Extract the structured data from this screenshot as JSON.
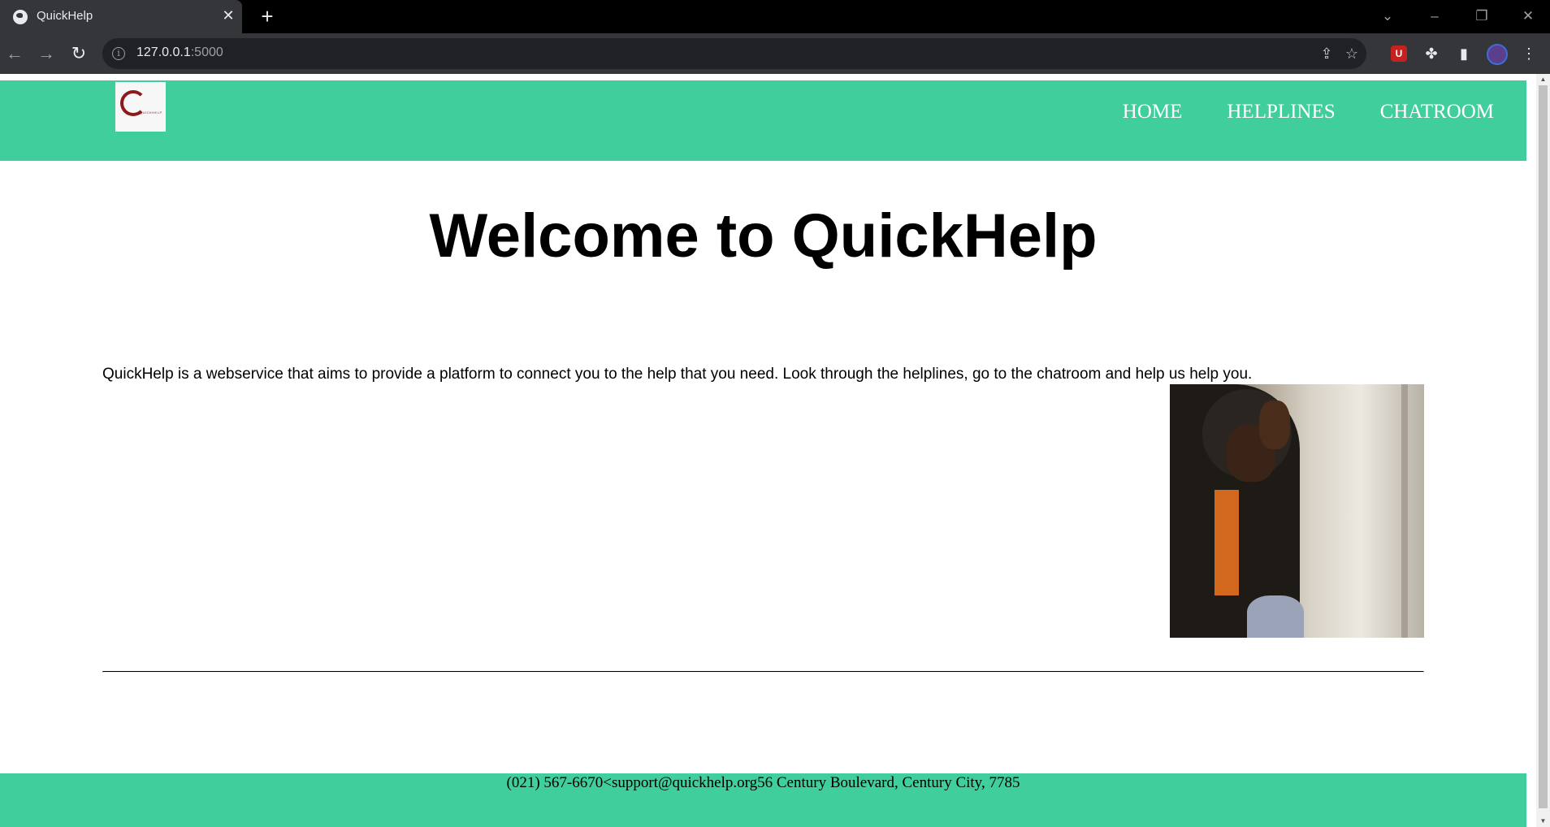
{
  "browser": {
    "tab_title": "QuickHelp",
    "url_host": "127.0.0.1",
    "url_port": ":5000"
  },
  "site": {
    "logo_text": "QUICKHELP",
    "nav": [
      {
        "label": "HOME"
      },
      {
        "label": "HELPLINES"
      },
      {
        "label": "CHATROOM"
      }
    ],
    "title": "Welcome to QuickHelp",
    "intro": "QuickHelp is a webservice that aims to provide a platform to connect you to the help that you need. Look through the helplines, go to the chatroom and help us help you.",
    "footer": "(021) 567-6670<support@quickhelp.org56 Century Boulevard, Century City, 7785"
  },
  "colors": {
    "brand_green": "#40ce9c",
    "chrome_dark": "#35363a",
    "logo_red": "#8b1a1a"
  }
}
